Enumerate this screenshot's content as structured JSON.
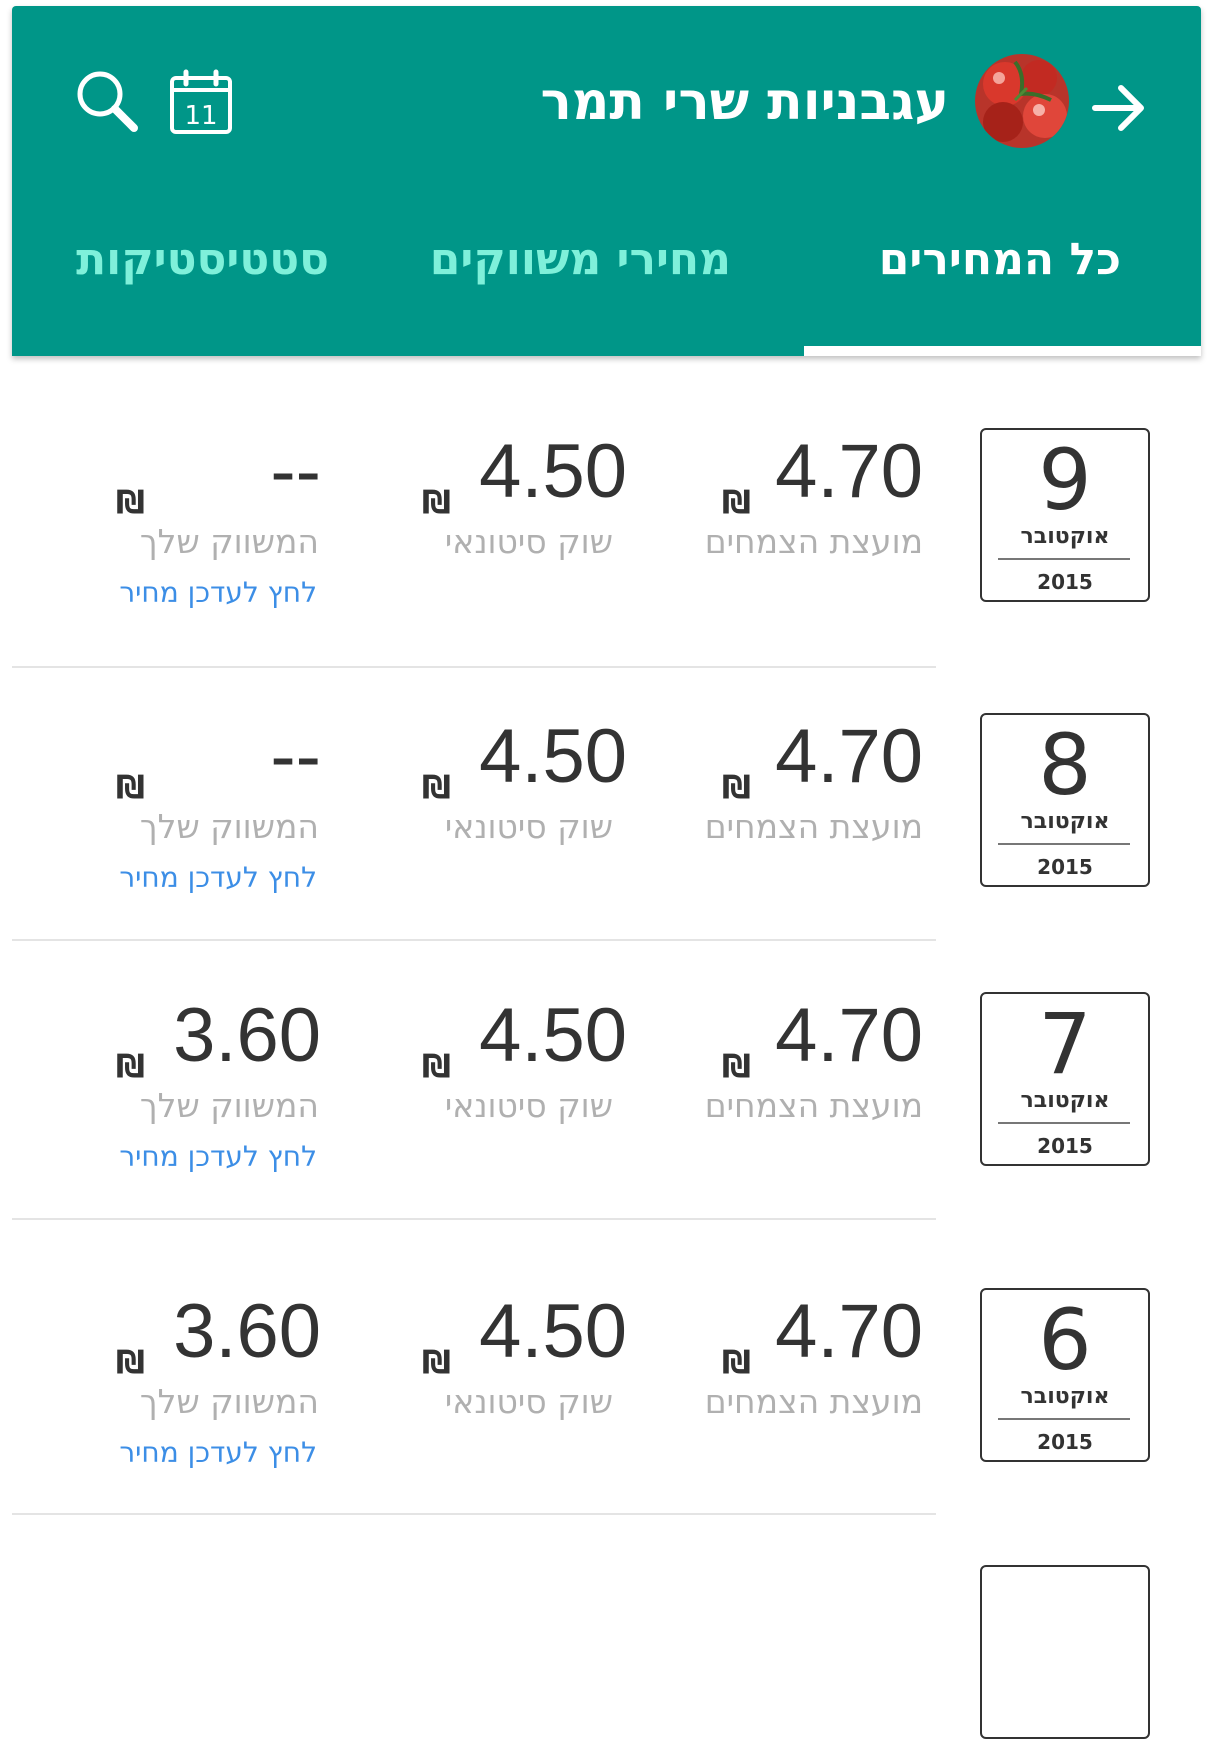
{
  "header": {
    "title": "עגבניות שרי תמר",
    "calendar_icon_day": "11",
    "background_color": "#009688"
  },
  "tabs": [
    {
      "label": "כל המחירים",
      "active": true
    },
    {
      "label": "מחירי משווקים",
      "active": false
    },
    {
      "label": "סטטיסטיקות",
      "active": false
    }
  ],
  "labels": {
    "council": "מועצת הצמחים",
    "wholesale": "שוק סיטונאי",
    "your_marketer": "המשווק שלך",
    "update_link": "לחץ לעדכן מחיר",
    "currency": "₪"
  },
  "rows": [
    {
      "day": "9",
      "month": "אוקטובר",
      "year": "2015",
      "council_price": "4.70",
      "wholesale_price": "4.50",
      "your_price": "--"
    },
    {
      "day": "8",
      "month": "אוקטובר",
      "year": "2015",
      "council_price": "4.70",
      "wholesale_price": "4.50",
      "your_price": "--"
    },
    {
      "day": "7",
      "month": "אוקטובר",
      "year": "2015",
      "council_price": "4.70",
      "wholesale_price": "4.50",
      "your_price": "3.60"
    },
    {
      "day": "6",
      "month": "אוקטובר",
      "year": "2015",
      "council_price": "4.70",
      "wholesale_price": "4.50",
      "your_price": "3.60"
    }
  ]
}
